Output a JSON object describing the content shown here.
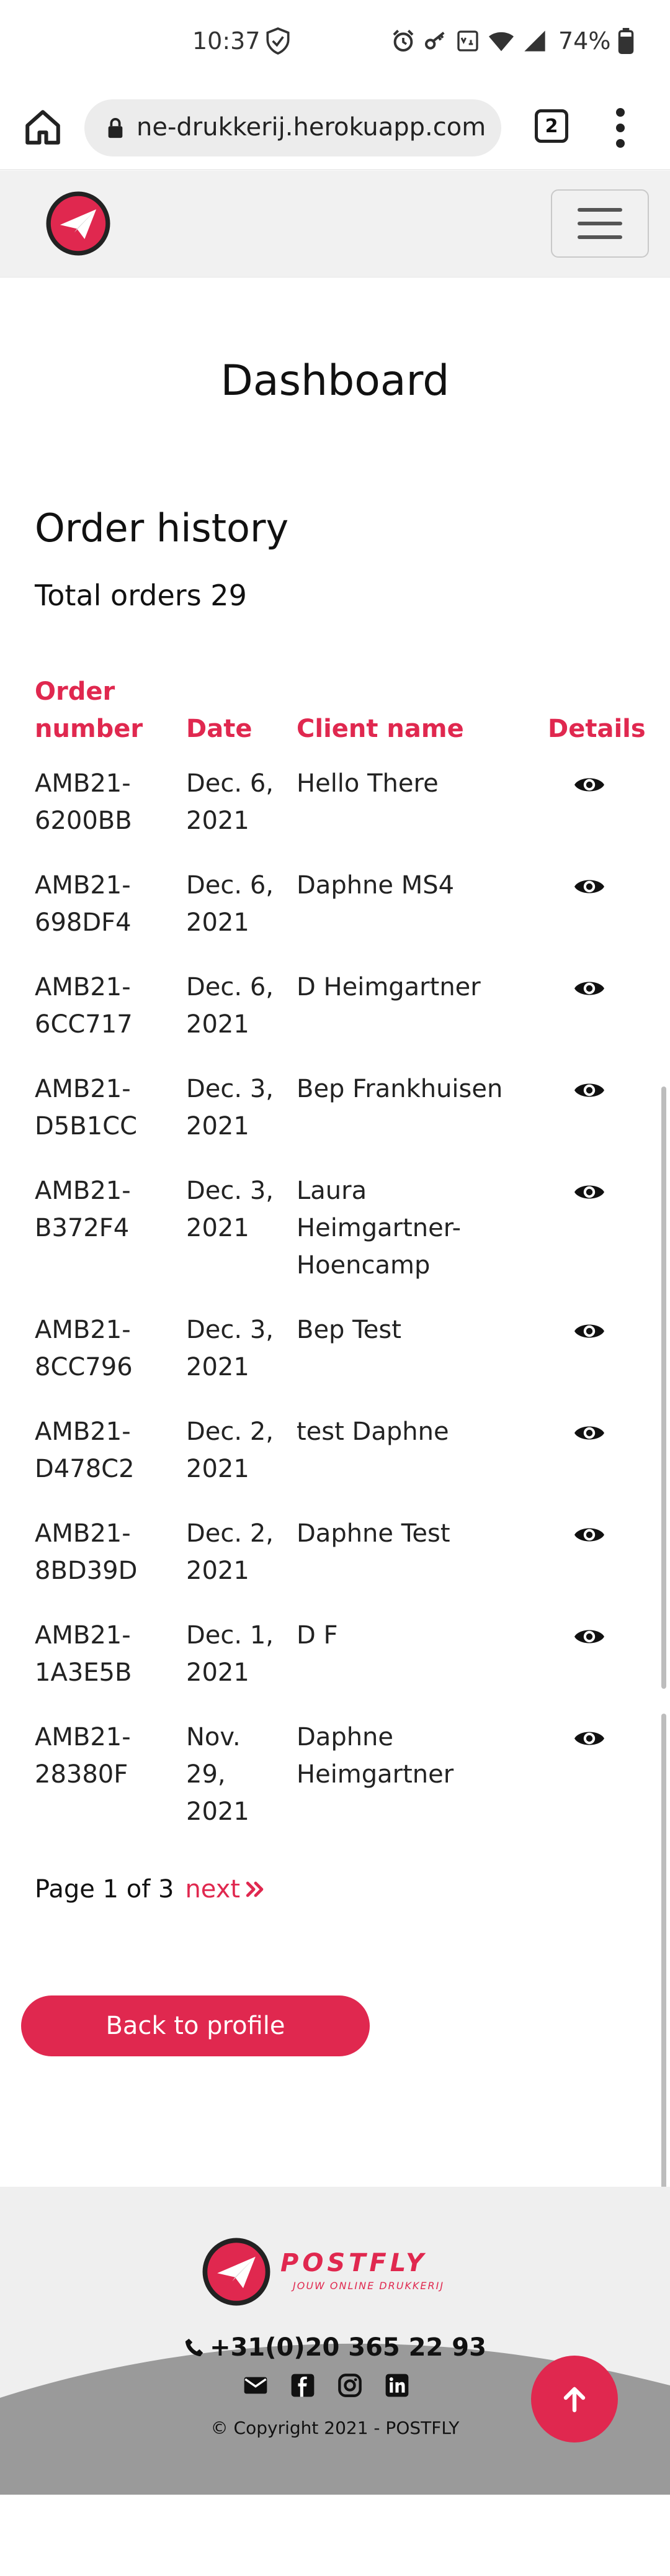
{
  "status_bar": {
    "time": "10:37",
    "battery": "74%"
  },
  "browser": {
    "url": "ne-drukkerij.herokuapp.com",
    "tab_count": "2"
  },
  "page": {
    "title": "Dashboard"
  },
  "orders": {
    "section_title": "Order history",
    "total_label": "Total orders 29",
    "columns": {
      "order_number": "Order number",
      "date": "Date",
      "client_name": "Client name",
      "details": "Details"
    },
    "rows": [
      {
        "order": "AMB21-\n6200BB",
        "date": "Dec. 6,\n2021",
        "client": "Hello There"
      },
      {
        "order": "AMB21-\n698DF4",
        "date": "Dec. 6,\n2021",
        "client": "Daphne MS4"
      },
      {
        "order": "AMB21-\n6CC717",
        "date": "Dec. 6,\n2021",
        "client": "D Heimgartner"
      },
      {
        "order": "AMB21-\nD5B1CC",
        "date": "Dec. 3,\n2021",
        "client": "Bep Frankhuisen"
      },
      {
        "order": "AMB21-\nB372F4",
        "date": "Dec. 3,\n2021",
        "client": "Laura\nHeimgartner-\nHoencamp"
      },
      {
        "order": "AMB21-\n8CC796",
        "date": "Dec. 3,\n2021",
        "client": "Bep Test"
      },
      {
        "order": "AMB21-\nD478C2",
        "date": "Dec. 2,\n2021",
        "client": "test Daphne"
      },
      {
        "order": "AMB21-\n8BD39D",
        "date": "Dec. 2,\n2021",
        "client": "Daphne Test"
      },
      {
        "order": "AMB21-\n1A3E5B",
        "date": "Dec. 1,\n2021",
        "client": "D F"
      },
      {
        "order": "AMB21-\n28380F",
        "date": "Nov.\n29,\n2021",
        "client": "Daphne\nHeimgartner"
      }
    ]
  },
  "pagination": {
    "label": "Page 1 of 3",
    "next": "next"
  },
  "actions": {
    "back_to_profile": "Back to profile"
  },
  "footer": {
    "brand": "POSTFLY",
    "tagline": "JOUW ONLINE DRUKKERIJ",
    "phone": "+31(0)20 365 22 93",
    "copyright": "© Copyright 2021 - POSTFLY"
  },
  "colors": {
    "accent": "#e0284f",
    "navbar_bg": "#f1f1f1",
    "footer_bg": "#efefef"
  },
  "icons": [
    "shield-icon",
    "alarm-icon",
    "key-icon",
    "wifi-icon",
    "signal-icon",
    "battery-icon",
    "home-icon",
    "lock-icon",
    "eye-icon",
    "chevron-right-icon",
    "phone-icon",
    "mail-icon",
    "facebook-icon",
    "instagram-icon",
    "linkedin-icon",
    "arrow-up-icon"
  ]
}
